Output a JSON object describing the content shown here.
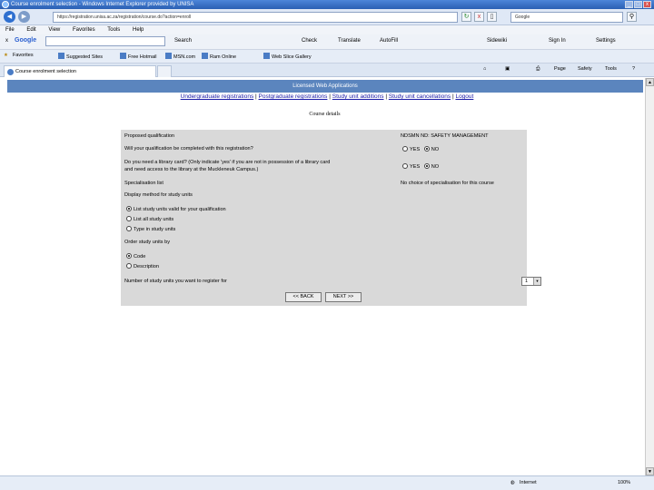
{
  "window": {
    "title": "Course enrolment selection - Windows Internet Explorer provided by UNISA",
    "minimize": "_",
    "maximize": "□",
    "close": "x"
  },
  "address": {
    "url": "https://registration.unisa.ac.za/registration/course.do?action=enroll",
    "back": "◀",
    "forward": "▶",
    "refresh": "↻",
    "stop": "x",
    "search_placeholder": "Google",
    "search_icon": "⚲"
  },
  "menu": [
    "File",
    "Edit",
    "View",
    "Favorites",
    "Tools",
    "Help"
  ],
  "google_toolbar": {
    "close": "x",
    "brand": "Google",
    "items": [
      "Search",
      "Check",
      "Translate",
      "AutoFill",
      "Sidewiki",
      "Sign In",
      "Settings"
    ]
  },
  "favorites_bar": {
    "label": "Favorites",
    "items": [
      "Suggested Sites",
      "Free Hotmail",
      "MSN.com",
      "Ram Online",
      "Web Slice Gallery"
    ]
  },
  "tabs": {
    "active": "Course enrolment selection"
  },
  "command_bar": [
    "Page",
    "Safety",
    "Tools"
  ],
  "page": {
    "banner": "Licensed Web Applications",
    "links": [
      "Undergraduate registrations",
      "Postgraduate registrations",
      "Study unit additions",
      "Study unit cancellations",
      "Logout"
    ],
    "separator": "|",
    "course_details_title": "Course details",
    "rows": {
      "proposed_label": "Proposed qualification",
      "proposed_value": "NDSMN ND: SAFETY MANAGEMENT",
      "complete_question": "Will your qualification be completed with this registration?",
      "library_question_1": "Do you need a library card? (Only indicate 'yes' if you are not in possession of a library card",
      "library_question_2": "and need access to the library at the Muckleneuk Campus.)",
      "yes": "YES",
      "no": "NO",
      "specialisation_label": "Specialisation list",
      "specialisation_value": "No choice of specialisation for this course",
      "display_method_label": "Display method for study units",
      "display_options": [
        "List study units valid for your qualification",
        "List all study units",
        "Type in study units"
      ],
      "order_label": "Order study units by",
      "order_options": [
        "Code",
        "Description"
      ],
      "number_label": "Number of study units you want to register for",
      "number_value": "1"
    },
    "buttons": {
      "back": "<< BACK",
      "next": "NEXT >>"
    }
  },
  "status": {
    "zone": "Internet",
    "zoom": "100%"
  }
}
